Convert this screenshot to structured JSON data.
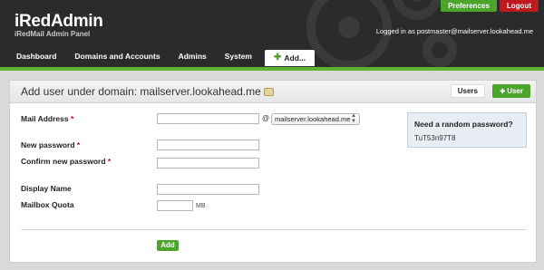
{
  "app": {
    "title": "iRedAdmin",
    "tagline": "iRedMail Admin Panel"
  },
  "top_links": {
    "preferences": "Preferences",
    "logout": "Logout"
  },
  "session": {
    "logged_in_text": "Logged in as postmaster@mailserver.lookahead.me"
  },
  "nav": {
    "dashboard": "Dashboard",
    "domains": "Domains and Accounts",
    "admins": "Admins",
    "system": "System",
    "add": "Add..."
  },
  "page": {
    "title": "Add user under domain: mailserver.lookahead.me",
    "tabs": {
      "users": "Users",
      "user": "User"
    }
  },
  "form": {
    "mail_address_label": "Mail Address",
    "at_sign": "@",
    "domain_select_value": "mailserver.lookahead.me",
    "new_password_label": "New password",
    "confirm_password_label": "Confirm new password",
    "display_name_label": "Display Name",
    "mailbox_quota_label": "Mailbox Quota",
    "quota_unit": "MB",
    "required_marker": "*",
    "submit_label": "Add"
  },
  "random_password": {
    "question": "Need a random password?",
    "value": "TuT53n97T8"
  },
  "colors": {
    "accent_green": "#4ca52b",
    "logout_red": "#c0191d",
    "header_dark": "#2b2b2b"
  }
}
